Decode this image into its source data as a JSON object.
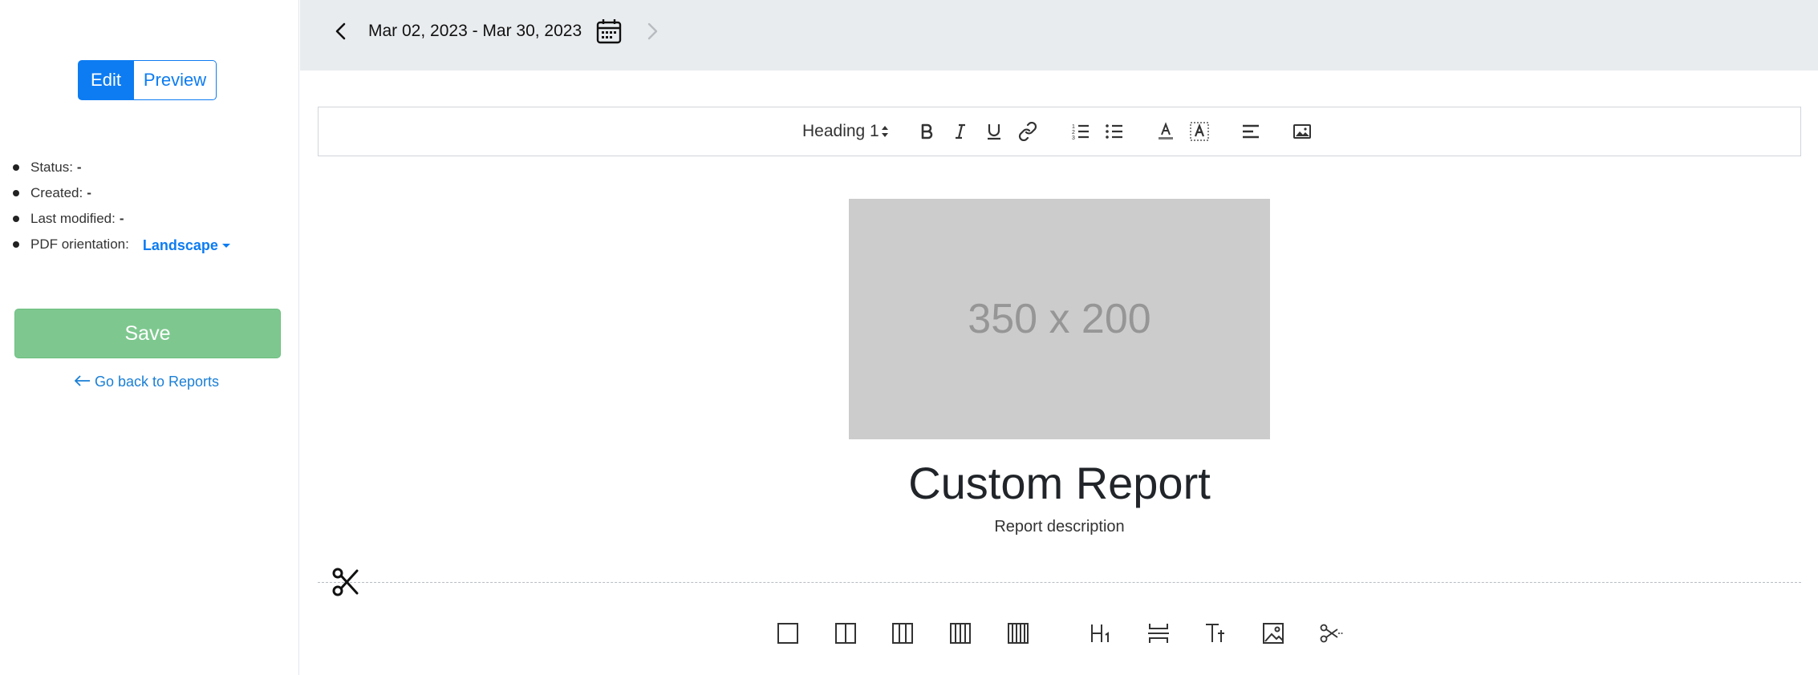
{
  "sidebar": {
    "mode_toggle": {
      "edit_label": "Edit",
      "preview_label": "Preview"
    },
    "meta": {
      "status_label": "Status:",
      "status_value": "-",
      "created_label": "Created:",
      "created_value": "-",
      "modified_label": "Last modified:",
      "modified_value": "-",
      "orientation_label": "PDF orientation:",
      "orientation_value": "Landscape"
    },
    "save_label": "Save",
    "back_link": "Go back to Reports"
  },
  "header": {
    "date_range": "Mar 02, 2023 - Mar 30, 2023"
  },
  "toolbar": {
    "heading_value": "Heading 1",
    "buttons": [
      "bold-icon",
      "italic-icon",
      "underline-icon",
      "link-icon",
      "ordered-list-icon",
      "bullet-list-icon",
      "text-color-icon",
      "highlight-icon",
      "align-left-icon",
      "image-icon"
    ]
  },
  "content": {
    "image_placeholder": "350 x 200",
    "title": "Custom Report",
    "description": "Report description"
  },
  "blocks_bar": {
    "icons": [
      "one-column-icon",
      "two-column-icon",
      "three-column-icon",
      "four-column-icon",
      "five-column-icon",
      "heading-block-icon",
      "divider-block-icon",
      "text-block-icon",
      "image-block-icon",
      "page-break-block-icon"
    ]
  },
  "colors": {
    "primary": "#0d7cf2",
    "save": "#7ec88f",
    "header_bg": "#e9ecef",
    "placeholder_bg": "#cccccc"
  }
}
